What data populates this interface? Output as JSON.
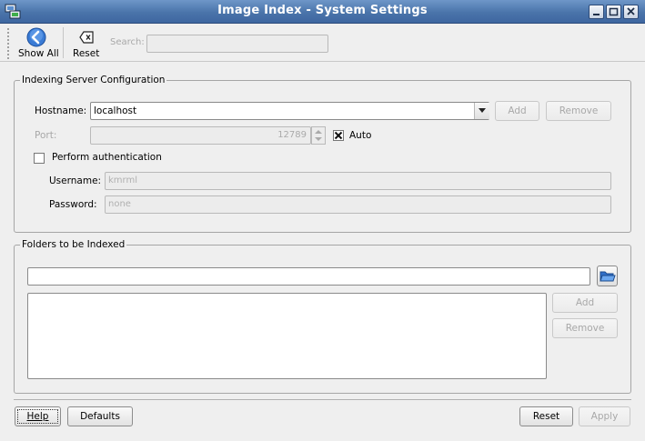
{
  "window": {
    "title": "Image Index - System Settings"
  },
  "toolbar": {
    "show_all_label": "Show All",
    "reset_label": "Reset",
    "search_label": "Search:",
    "search_value": ""
  },
  "indexing_server": {
    "group_title": "Indexing Server Configuration",
    "hostname_label": "Hostname:",
    "hostname_value": "localhost",
    "add_label": "Add",
    "remove_label": "Remove",
    "port_label": "Port:",
    "port_value": "12789",
    "auto_label": "Auto",
    "auto_checked": true,
    "perform_auth_label": "Perform authentication",
    "perform_auth_checked": false,
    "username_label": "Username:",
    "username_value": "kmrml",
    "password_label": "Password:",
    "password_value": "none"
  },
  "folders": {
    "group_title": "Folders to be Indexed",
    "path_value": "",
    "add_label": "Add",
    "remove_label": "Remove"
  },
  "footer": {
    "help_label": "Help",
    "defaults_label": "Defaults",
    "reset_label": "Reset",
    "apply_label": "Apply"
  },
  "colors": {
    "titlebar": "#4a74aa",
    "accent_blue": "#3a7bd5"
  }
}
